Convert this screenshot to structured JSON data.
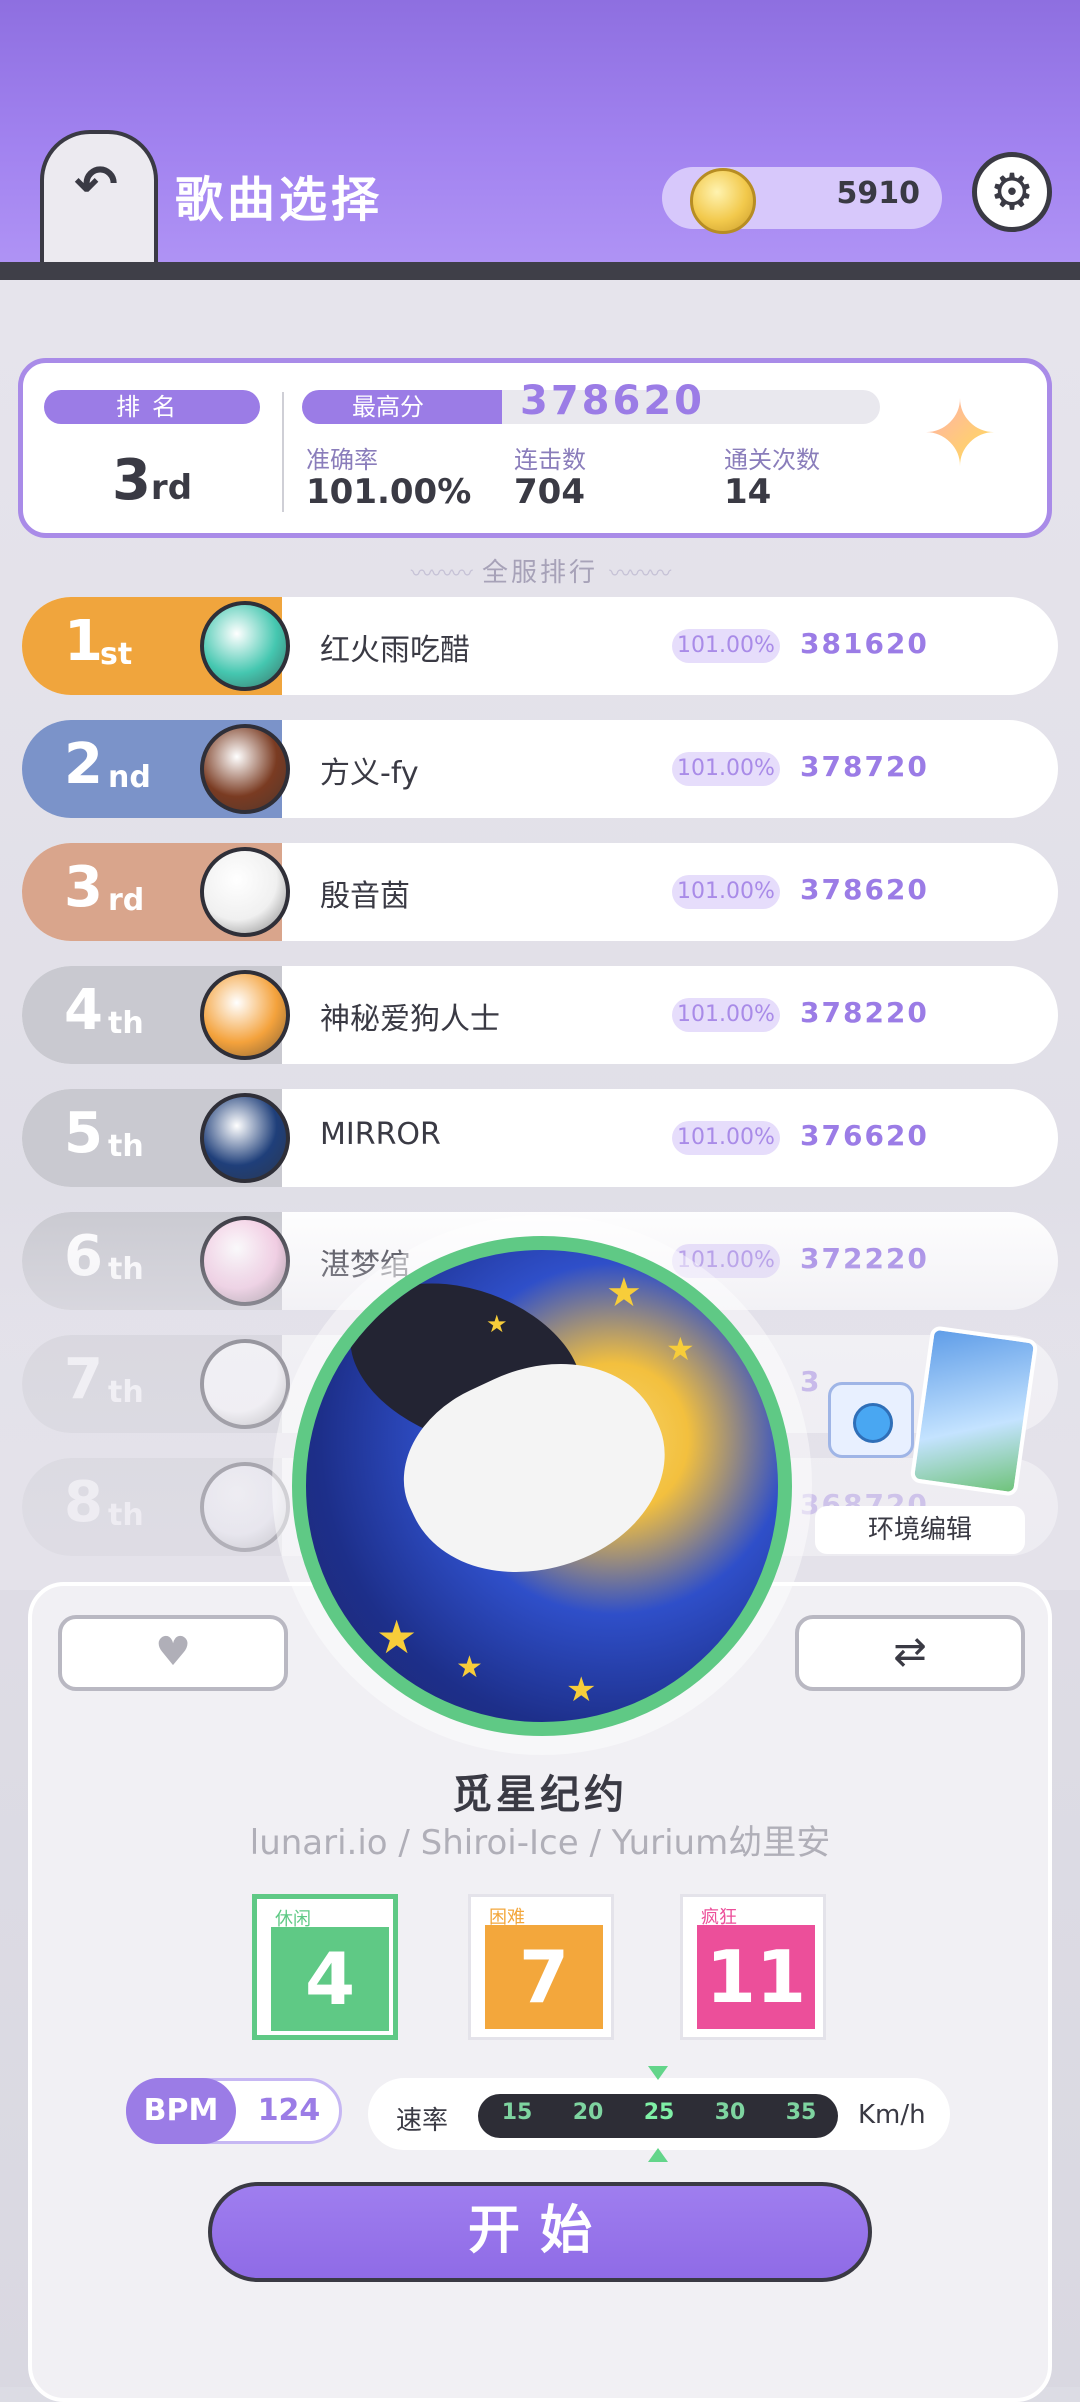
{
  "header": {
    "title": "歌曲选择",
    "coins": "5910"
  },
  "score_panel": {
    "rank_label": "排名",
    "rank_number": "3",
    "rank_suffix": "rd",
    "highscore_label": "最高分",
    "highscore_value": "378620",
    "accuracy_label": "准确率",
    "accuracy_value": "101.00%",
    "combo_label": "连击数",
    "combo_value": "704",
    "clears_label": "通关次数",
    "clears_value": "14"
  },
  "server_rank_label": "全服排行",
  "leaderboard": [
    {
      "num": "1",
      "suffix": "st",
      "name": "红火雨吃醋",
      "acc": "101.00%",
      "score": "381620",
      "color": "#f0a53d"
    },
    {
      "num": "2",
      "suffix": "nd",
      "name": "方义-fy",
      "acc": "101.00%",
      "score": "378720",
      "color": "#7b93c9"
    },
    {
      "num": "3",
      "suffix": "rd",
      "name": "殷音茵",
      "acc": "101.00%",
      "score": "378620",
      "color": "#d9a58c"
    },
    {
      "num": "4",
      "suffix": "th",
      "name": "神秘爱狗人士",
      "acc": "101.00%",
      "score": "378220",
      "color": "#c9c9d0"
    },
    {
      "num": "5",
      "suffix": "th",
      "name": "MIRROR",
      "acc": "101.00%",
      "score": "376620",
      "color": "#c9c9d0"
    },
    {
      "num": "6",
      "suffix": "th",
      "name": "湛梦绾",
      "acc": "101.00%",
      "score": "372220",
      "color": "#c9c9d0"
    },
    {
      "num": "7",
      "suffix": "th",
      "name": "",
      "acc": "",
      "score": "3",
      "color": "#c9c9d0"
    },
    {
      "num": "8",
      "suffix": "th",
      "name": "",
      "acc": "",
      "score": "368720",
      "color": "#c9c9d0"
    }
  ],
  "environment_label": "环境编辑",
  "song": {
    "title": "觅星纪约",
    "artist": "lunari.io / Shiroi-Ice / Yurium幼里安"
  },
  "difficulties": [
    {
      "label": "休闲",
      "level": "4",
      "color": "#5fc985",
      "selected": true
    },
    {
      "label": "困难",
      "level": "7",
      "color": "#f3a73c",
      "selected": false
    },
    {
      "label": "疯狂",
      "level": "11",
      "color": "#ec4f9a",
      "selected": false
    }
  ],
  "bpm": {
    "label": "BPM",
    "value": "124"
  },
  "speed": {
    "label": "速率",
    "unit": "Km/h",
    "ticks": [
      "15",
      "20",
      "25",
      "30",
      "35"
    ],
    "selected": "25"
  },
  "start_label": "开始",
  "icons": {
    "back": "back-arrow-icon",
    "settings": "gear-icon",
    "coin": "coin-icon",
    "favorite": "heart-icon",
    "shuffle": "shuffle-icon"
  }
}
